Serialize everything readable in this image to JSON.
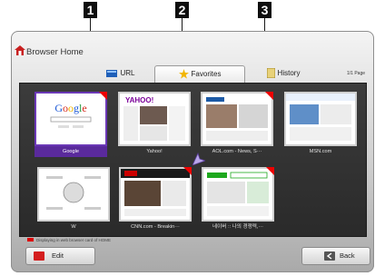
{
  "callouts": [
    "1",
    "2",
    "3"
  ],
  "header": {
    "title": "Browser Home"
  },
  "tabs": [
    {
      "label": "URL"
    },
    {
      "label": "Favorites"
    },
    {
      "label": "History"
    }
  ],
  "page_indicator": "1/1 Page",
  "thumbnails": [
    {
      "label": "Google"
    },
    {
      "label": "Yahoo!"
    },
    {
      "label": "AOL.com - News, S···"
    },
    {
      "label": "MSN.com"
    },
    {
      "label": "W"
    },
    {
      "label": "CNN.com - Breakin···"
    },
    {
      "label": "네이버 :: 나의 경쟁력,···"
    }
  ],
  "legend_text": "Displaying in web browser card of HOME",
  "buttons": {
    "edit": "Edit",
    "back": "Back"
  },
  "colors": {
    "selected": "#6b38b6",
    "accent_red": "#e00000"
  }
}
